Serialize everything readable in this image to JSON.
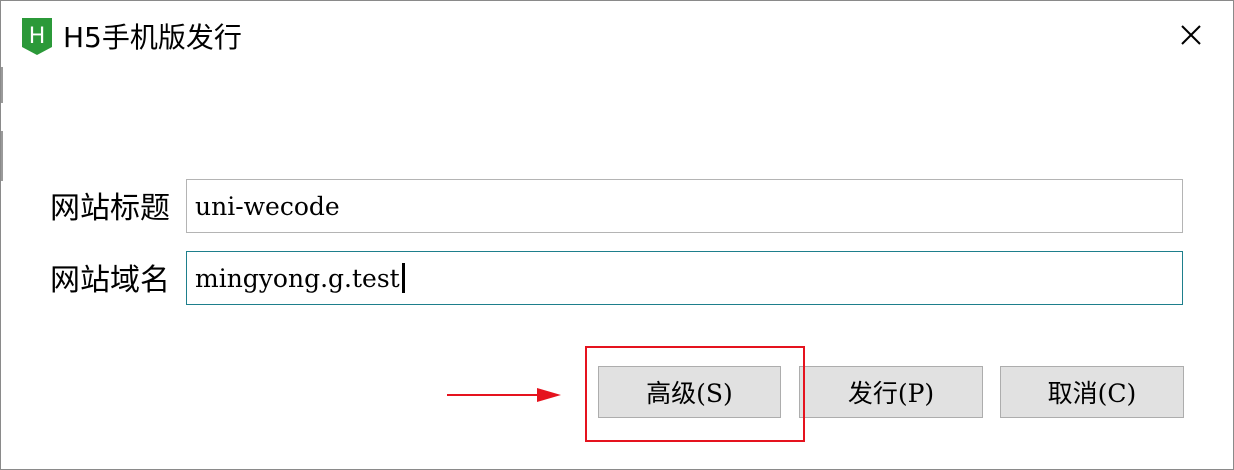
{
  "window": {
    "title": "H5手机版发行",
    "app_icon_letter": "H",
    "close_glyph": "✕"
  },
  "form": {
    "site_title": {
      "label": "网站标题",
      "value": "uni-wecode"
    },
    "site_domain": {
      "label": "网站域名",
      "value": "mingyong.g.test"
    }
  },
  "buttons": {
    "advanced": "高级(S)",
    "publish": "发行(P)",
    "cancel": "取消(C)"
  },
  "annotation": {
    "highlight_color": "#e5131e",
    "arrow_color": "#e5131e",
    "target": "advanced"
  },
  "colors": {
    "brand_green": "#2b9939",
    "focused_border": "#1e7f8c",
    "button_face": "#e1e1e1"
  }
}
